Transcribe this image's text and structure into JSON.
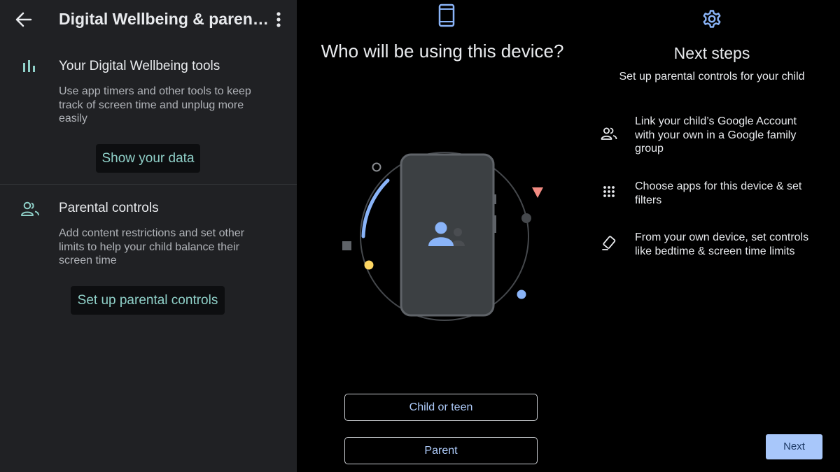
{
  "wellbeing": {
    "title": "Digital Wellbeing & paren…",
    "tools": {
      "title": "Your Digital Wellbeing tools",
      "description": "Use app timers and other tools to keep track of screen time and unplug more easily",
      "button": "Show your data"
    },
    "parental": {
      "title": "Parental controls",
      "description": "Add content restrictions and set other limits to help your child balance their screen time",
      "button": "Set up parental controls"
    }
  },
  "who": {
    "title": "Who will be using this device?",
    "options": [
      "Child or teen",
      "Parent"
    ]
  },
  "next_steps": {
    "title": "Next steps",
    "subtitle": "Set up parental controls for your child",
    "steps": [
      {
        "icon": "people-icon",
        "text": "Link your child’s Google Account with your own in a Google family group"
      },
      {
        "icon": "apps-grid-icon",
        "text": "Choose apps for this device & set filters"
      },
      {
        "icon": "device-rotate-icon",
        "text": "From your own device, set controls like bedtime & screen time limits"
      }
    ],
    "next_label": "Next"
  },
  "colors": {
    "panel_bg": "#202124",
    "teal_accent": "#8fd0c8",
    "blue_accent": "#8ab4f8",
    "next_button": "#a8c7fa"
  }
}
